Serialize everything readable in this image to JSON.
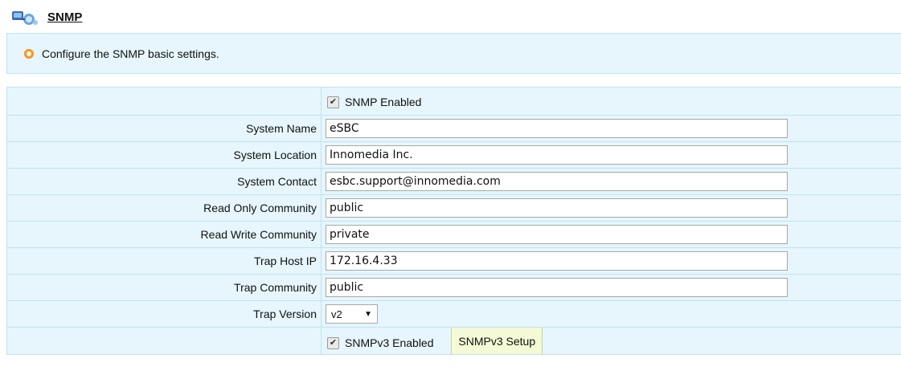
{
  "header": {
    "title": "SNMP",
    "logo_icon": "snmp-network-icon"
  },
  "info": {
    "text": "Configure the SNMP basic settings.",
    "icon": "bullet-circle-icon"
  },
  "snmp_enabled": {
    "label": "SNMP Enabled",
    "checked": true
  },
  "fields": [
    {
      "label": "System Name",
      "value": "eSBC"
    },
    {
      "label": "System Location",
      "value": "Innomedia Inc."
    },
    {
      "label": "System Contact",
      "value": "esbc.support@innomedia.com"
    },
    {
      "label": "Read Only Community",
      "value": "public"
    },
    {
      "label": "Read Write Community",
      "value": "private"
    },
    {
      "label": "Trap Host IP",
      "value": "172.16.4.33"
    },
    {
      "label": "Trap Community",
      "value": "public"
    }
  ],
  "trap_version": {
    "label": "Trap Version",
    "selected": "v2"
  },
  "snmpv3": {
    "label": "SNMPv3 Enabled",
    "checked": true,
    "setup_button": "SNMPv3 Setup"
  },
  "colors": {
    "panel_bg": "#e6f6fc",
    "border": "#bfe3f2",
    "bullet": "#e98b16",
    "button_bg": "#f4f9d6"
  }
}
